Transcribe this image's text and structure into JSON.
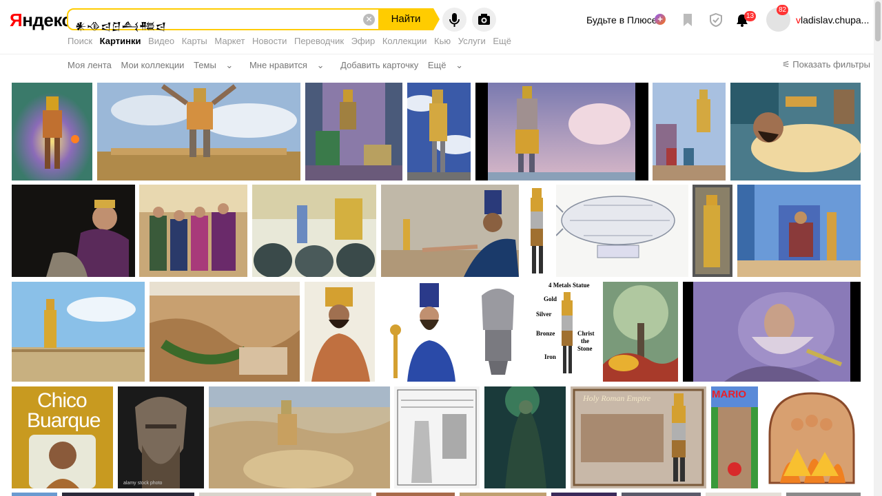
{
  "header": {
    "logo_part1": "Я",
    "logo_part2": "ндекс",
    "search_value": "𒀭𒈾𒁀𒆪𒋀𒍣𒁀",
    "search_button": "Найти",
    "plus_label": "Будьте в Плюсе",
    "plus_badge": "+",
    "notifications_count": "13",
    "avatar_count": "82",
    "user_initial": "v",
    "user_rest": "ladislav.chupa..."
  },
  "services": [
    {
      "label": "Поиск",
      "active": false
    },
    {
      "label": "Картинки",
      "active": true
    },
    {
      "label": "Видео",
      "active": false
    },
    {
      "label": "Карты",
      "active": false
    },
    {
      "label": "Маркет",
      "active": false
    },
    {
      "label": "Новости",
      "active": false
    },
    {
      "label": "Переводчик",
      "active": false
    },
    {
      "label": "Эфир",
      "active": false
    },
    {
      "label": "Коллекции",
      "active": false
    },
    {
      "label": "Кью",
      "active": false
    },
    {
      "label": "Услуги",
      "active": false
    },
    {
      "label": "Ещё",
      "active": false
    }
  ],
  "subnav": {
    "feed": "Моя лента",
    "collections": "Мои коллекции",
    "themes": "Темы",
    "likes": "Мне нравится",
    "add_card": "Добавить карточку",
    "more": "Ещё",
    "filters": "Показать фильтры"
  },
  "tile_texts": {
    "metals_title": "4 Metals Statue",
    "gold": "Gold",
    "silver": "Silver",
    "bronze": "Bronze",
    "iron": "Iron",
    "christ": "Christ",
    "the": "the",
    "stone": "Stone",
    "chico": "Chico",
    "buarque": "Buarque",
    "alamy": "alamy stock photo",
    "holy_roman": "Holy Roman Empire",
    "mario": "MARIO"
  },
  "colors": {
    "accent": "#ffcc00",
    "logo_red": "#ff0000",
    "badge_red": "#ff3333"
  }
}
